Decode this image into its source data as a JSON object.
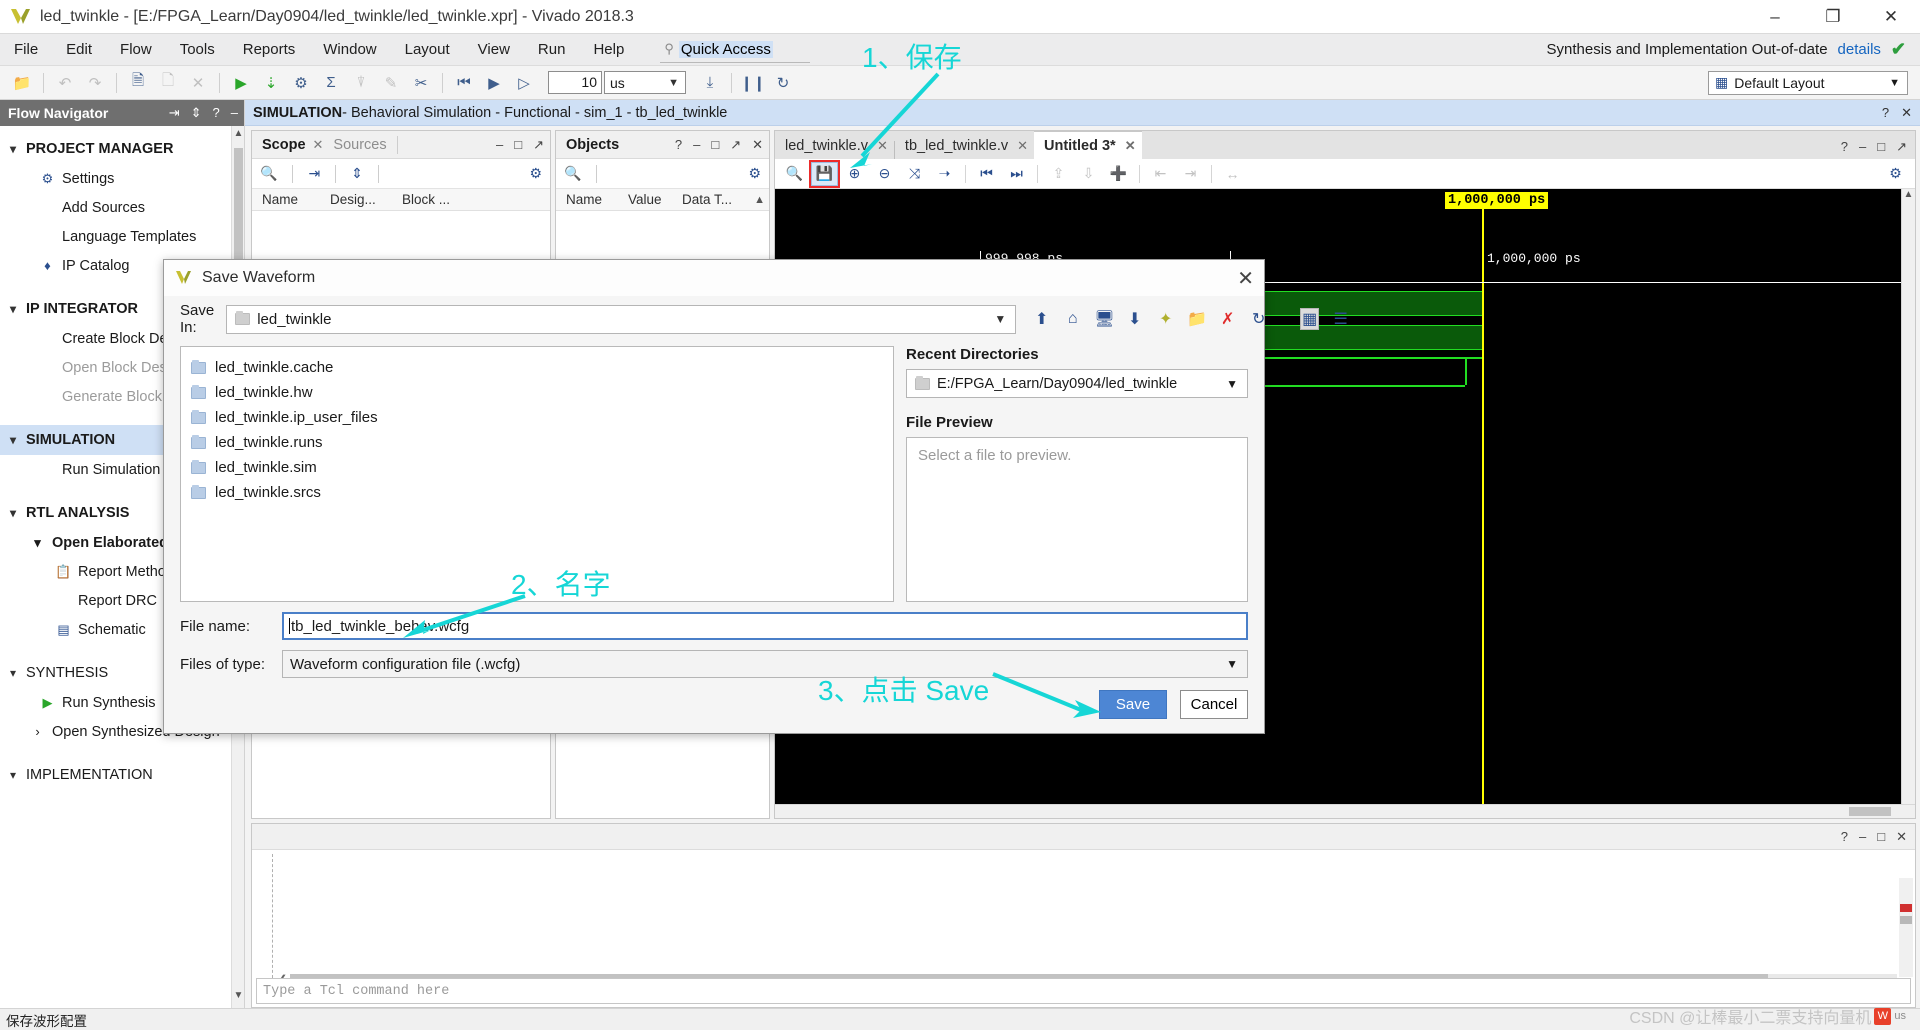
{
  "window": {
    "title": "led_twinkle - [E:/FPGA_Learn/Day0904/led_twinkle/led_twinkle.xpr] - Vivado 2018.3",
    "minimize": "–",
    "maximize": "❐",
    "close": "✕"
  },
  "menubar": {
    "items": [
      "File",
      "Edit",
      "Flow",
      "Tools",
      "Reports",
      "Window",
      "Layout",
      "View",
      "Run",
      "Help"
    ],
    "quick_access_placeholder": "Quick Access",
    "status_text": "Synthesis and Implementation Out-of-date",
    "details_link": "details",
    "check_icon": "✔"
  },
  "toolbar": {
    "runtime_value": "10",
    "runtime_unit": "us",
    "layout_label": "Default Layout",
    "icons": [
      "open-project-icon",
      "undo-icon",
      "redo-icon",
      "copy-icon",
      "paste-icon",
      "delete-icon",
      "run-icon",
      "compile-icon",
      "settings-icon",
      "sum-icon",
      "report-icon",
      "edit-icon",
      "cut-icon",
      "restart-icon",
      "run-all-icon",
      "run-for-icon"
    ]
  },
  "flow_navigator": {
    "title": "Flow Navigator",
    "header_icons": [
      "collapse-all-icon",
      "expand-icon",
      "help-icon",
      "minimize-icon"
    ],
    "items": [
      {
        "label": "PROJECT MANAGER",
        "type": "group",
        "expanded": true
      },
      {
        "label": "Settings",
        "type": "item",
        "icon": "gear-icon"
      },
      {
        "label": "Add Sources",
        "type": "item",
        "icon": ""
      },
      {
        "label": "Language Templates",
        "type": "item",
        "icon": ""
      },
      {
        "label": "IP Catalog",
        "type": "item",
        "icon": "ip-icon"
      },
      {
        "label": "IP INTEGRATOR",
        "type": "group",
        "expanded": true
      },
      {
        "label": "Create Block Design",
        "type": "item",
        "icon": ""
      },
      {
        "label": "Open Block Design",
        "type": "item",
        "icon": "",
        "disabled": true
      },
      {
        "label": "Generate Block Design",
        "type": "item",
        "icon": "",
        "disabled": true
      },
      {
        "label": "SIMULATION",
        "type": "group",
        "expanded": true,
        "selected": true
      },
      {
        "label": "Run Simulation",
        "type": "item",
        "icon": ""
      },
      {
        "label": "RTL ANALYSIS",
        "type": "group",
        "expanded": true
      },
      {
        "label": "Open Elaborated Design",
        "type": "subgroup",
        "expanded": true
      },
      {
        "label": "Report Methodology",
        "type": "item2",
        "icon": "clipboard-icon"
      },
      {
        "label": "Report DRC",
        "type": "item2",
        "icon": ""
      },
      {
        "label": "Schematic",
        "type": "item2",
        "icon": "schematic-icon"
      },
      {
        "label": "SYNTHESIS",
        "type": "group",
        "expanded": true
      },
      {
        "label": "Run Synthesis",
        "type": "item",
        "icon": "play-icon"
      },
      {
        "label": "Open Synthesized Design",
        "type": "subgroup-collapsed"
      },
      {
        "label": "IMPLEMENTATION",
        "type": "group",
        "expanded": true
      }
    ]
  },
  "simulation_bar": {
    "prefix": "SIMULATION",
    "suffix": " - Behavioral Simulation - Functional - sim_1 - tb_led_twinkle",
    "icons": [
      "help-icon",
      "close-icon"
    ]
  },
  "scope_pane": {
    "tabs": [
      {
        "label": "Scope",
        "active": true
      },
      {
        "label": "Sources",
        "active": false
      }
    ],
    "header_icons": [
      "minimize-icon",
      "maximize-icon",
      "float-icon"
    ],
    "toolbar_icons": [
      "search-icon",
      "collapse-icon",
      "expand-icon",
      "gear-icon"
    ],
    "columns": [
      "Name",
      "Desig...",
      "Block ..."
    ]
  },
  "objects_pane": {
    "title": "Objects",
    "header_icons": [
      "help-icon",
      "minimize-icon",
      "maximize-icon",
      "float-icon",
      "close-icon"
    ],
    "toolbar_icons": [
      "search-icon",
      "gear-icon"
    ],
    "columns": [
      "Name",
      "Value",
      "Data T..."
    ]
  },
  "wave_pane": {
    "tabs": [
      {
        "label": "led_twinkle.v",
        "active": false
      },
      {
        "label": "tb_led_twinkle.v",
        "active": false
      },
      {
        "label": "Untitled 3*",
        "active": true
      }
    ],
    "header_icons": [
      "help-icon",
      "minimize-icon",
      "maximize-icon",
      "float-icon"
    ],
    "toolbar_icons": [
      "search-icon",
      "save-waveform-icon",
      "zoom-in-icon",
      "zoom-out-icon",
      "zoom-fit-icon",
      "goto-time-icon",
      "previous-transition-icon",
      "next-transition-icon",
      "add-divider-icon",
      "add-group-icon",
      "add-marker-icon",
      "previous-marker-icon",
      "next-marker-icon",
      "measure-icon"
    ],
    "gear_icon": "gear-icon",
    "highlighted_tool": "save-waveform-icon"
  },
  "waveform": {
    "cursor_label": "1,000,000 ps",
    "time_labels": [
      "999,998 ps",
      "1,000,000 ps"
    ]
  },
  "console": {
    "header_icons": [
      "help-icon",
      "minimize-icon",
      "maximize-icon",
      "close-icon"
    ],
    "tcl_placeholder": "Type a Tcl command here"
  },
  "statusbar": {
    "text": "保存波形配置",
    "watermark": "CSDN @让棒最小二票支持向量机",
    "watermark_unit": "us"
  },
  "dialog": {
    "title": "Save Waveform",
    "close_icon": "✕",
    "save_in_label": "Save In:",
    "save_in_value": "led_twinkle",
    "toolbar_icons": [
      "up-folder-icon",
      "home-icon",
      "desktop-icon",
      "download-icon",
      "vivado-icon",
      "new-folder-icon",
      "delete-icon",
      "refresh-icon",
      "details-view-icon",
      "list-view-icon"
    ],
    "files": [
      "led_twinkle.cache",
      "led_twinkle.hw",
      "led_twinkle.ip_user_files",
      "led_twinkle.runs",
      "led_twinkle.sim",
      "led_twinkle.srcs"
    ],
    "recent_directories_label": "Recent Directories",
    "recent_directory_value": "E:/FPGA_Learn/Day0904/led_twinkle",
    "file_preview_label": "File Preview",
    "file_preview_placeholder": "Select a file to preview.",
    "file_name_label": "File name:",
    "file_name_value": "tb_led_twinkle_behav.wcfg",
    "files_of_type_label": "Files of type:",
    "files_of_type_value": "Waveform configuration file (.wcfg)",
    "save_button": "Save",
    "cancel_button": "Cancel"
  },
  "annotations": [
    {
      "id": "step1",
      "text": "1、保存"
    },
    {
      "id": "step2",
      "text": "2、名字"
    },
    {
      "id": "step3",
      "text": "3、点击 Save"
    }
  ],
  "colors": {
    "accent": "#16d6d6",
    "highlight_box": "#ec2b2b",
    "selection": "#cfe0f5",
    "primary_button": "#4d86d4",
    "waveform_green": "#22dd22",
    "cursor_yellow": "#ffff00"
  }
}
